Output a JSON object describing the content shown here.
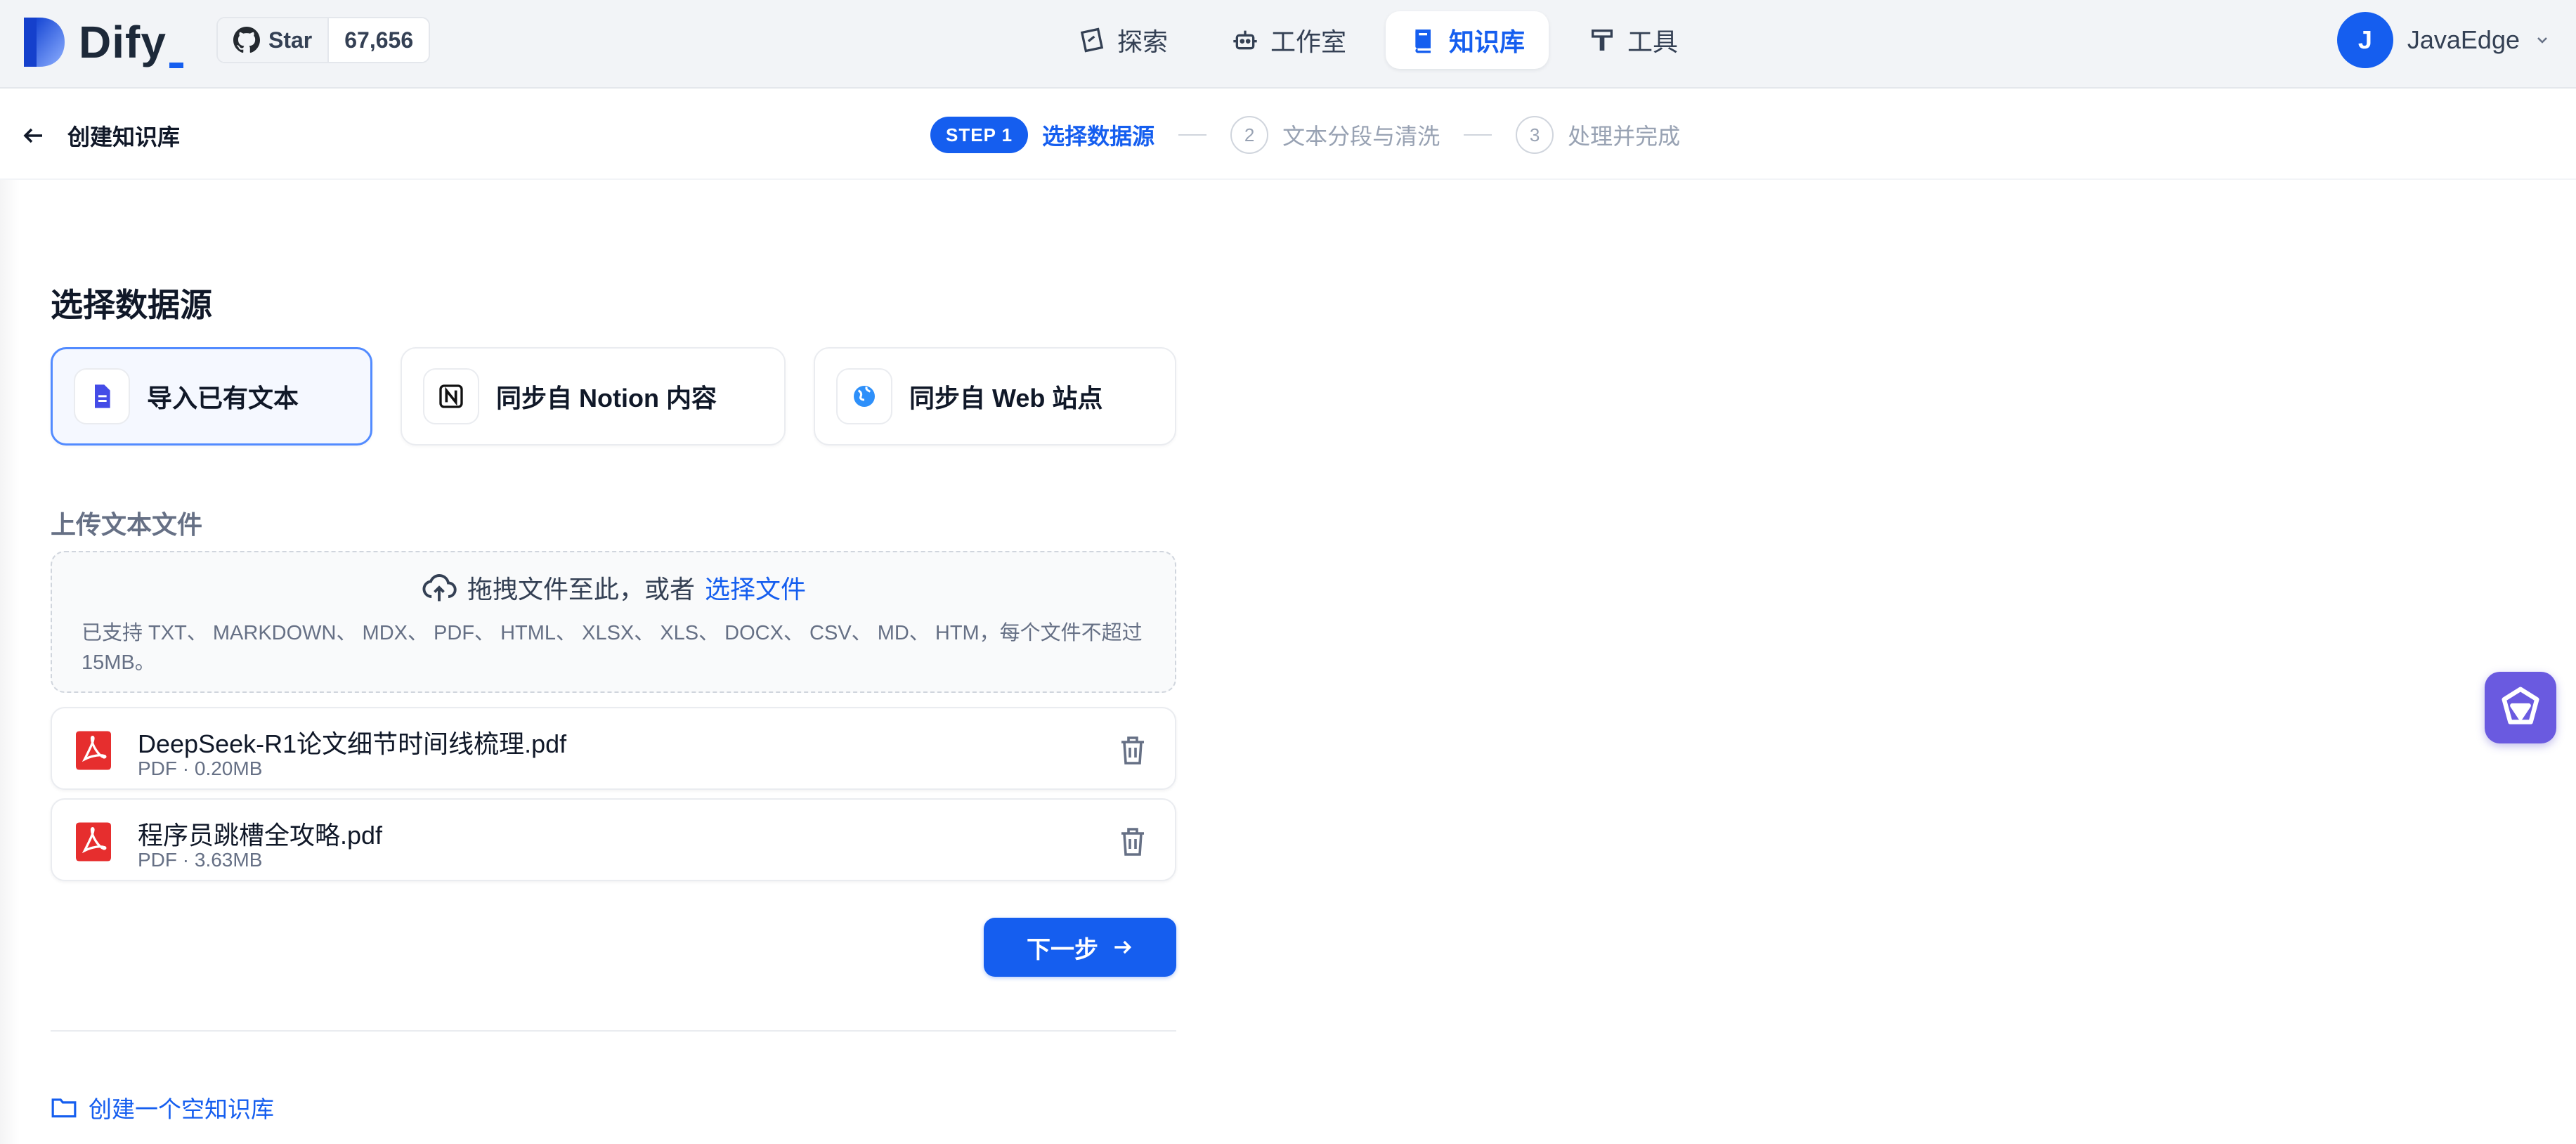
{
  "app": {
    "name": "Dify"
  },
  "github": {
    "label": "Star",
    "count": "67,656"
  },
  "nav": {
    "items": [
      {
        "label": "探索",
        "icon": "compass-icon"
      },
      {
        "label": "工作室",
        "icon": "robot-icon"
      },
      {
        "label": "知识库",
        "icon": "book-icon",
        "active": true
      },
      {
        "label": "工具",
        "icon": "hammer-icon"
      }
    ]
  },
  "user": {
    "initial": "J",
    "name": "JavaEdge"
  },
  "stepbar": {
    "back_label": "创建知识库",
    "step_badge": "STEP 1",
    "steps": [
      {
        "number": "1",
        "label": "选择数据源",
        "active": true
      },
      {
        "number": "2",
        "label": "文本分段与清洗"
      },
      {
        "number": "3",
        "label": "处理并完成"
      }
    ]
  },
  "content": {
    "title": "选择数据源",
    "sources": [
      {
        "label": "导入已有文本",
        "icon": "document-icon",
        "active": true
      },
      {
        "label": "同步自 Notion 内容",
        "icon": "notion-icon"
      },
      {
        "label": "同步自 Web 站点",
        "icon": "globe-icon"
      }
    ],
    "upload_title": "上传文本文件",
    "dropzone": {
      "text": "拖拽文件至此，或者",
      "link": "选择文件",
      "hint": "已支持 TXT、 MARKDOWN、 MDX、 PDF、 HTML、 XLSX、 XLS、 DOCX、 CSV、 MD、 HTM，每个文件不超过 15MB。"
    },
    "files": [
      {
        "name": "DeepSeek-R1论文细节时间线梳理.pdf",
        "meta": "PDF · 0.20MB"
      },
      {
        "name": "程序员跳槽全攻略.pdf",
        "meta": "PDF · 3.63MB"
      }
    ],
    "next_label": "下一步",
    "empty_kb_label": "创建一个空知识库"
  },
  "colors": {
    "accent": "#155eef",
    "pdf": "#e62e2e",
    "assistant": "#6a5ae0"
  }
}
